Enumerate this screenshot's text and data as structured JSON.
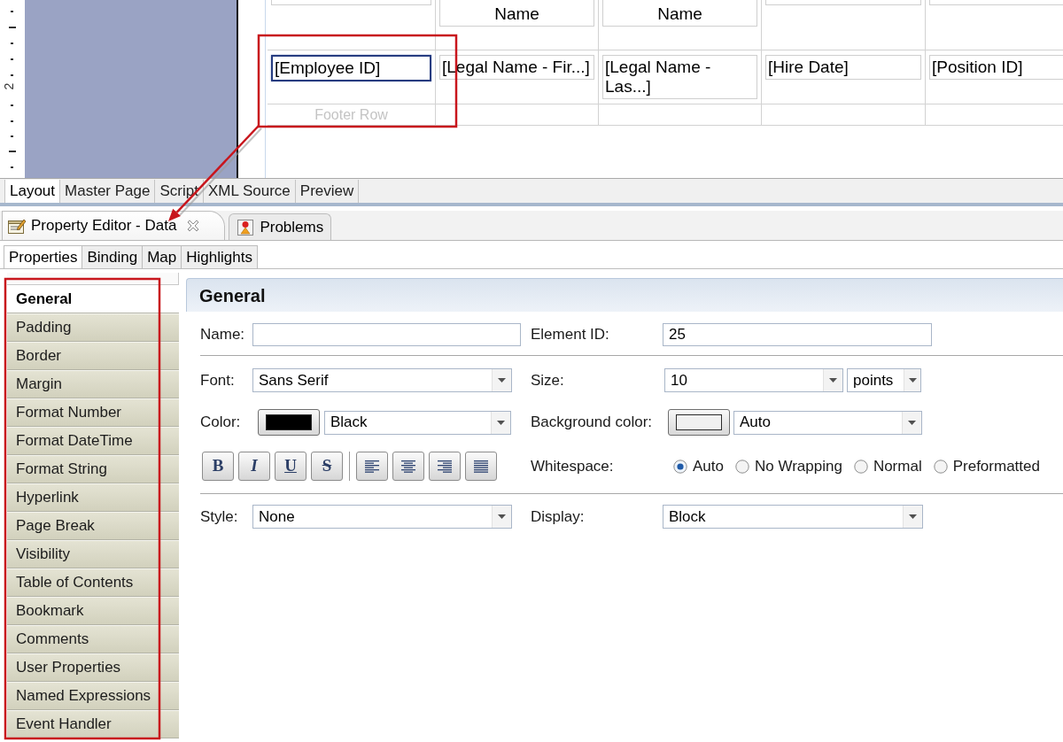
{
  "ruler": {
    "label": "2"
  },
  "report_table": {
    "columns": [
      {
        "detail": "[Employee ID]",
        "selected": true,
        "footer": "Footer Row"
      },
      {
        "header": "Name",
        "detail": "[Legal Name - Fir...]",
        "selected": false
      },
      {
        "header": "Name",
        "detail": "[Legal Name - Las...]",
        "selected": false
      },
      {
        "detail": "[Hire Date]",
        "selected": false
      },
      {
        "detail": "[Position ID]",
        "selected": false
      }
    ]
  },
  "editor_tabs": [
    {
      "label": "Layout",
      "selected": true
    },
    {
      "label": "Master Page",
      "selected": false
    },
    {
      "label": "Script",
      "selected": false
    },
    {
      "label": "XML Source",
      "selected": false
    },
    {
      "label": "Preview",
      "selected": false
    }
  ],
  "view_tabs": [
    {
      "kind": "property_editor",
      "label": "Property Editor - Data",
      "selected": true
    },
    {
      "kind": "problems",
      "label": "Problems",
      "selected": false
    }
  ],
  "property_tabs": [
    {
      "label": "Properties",
      "selected": true
    },
    {
      "label": "Binding",
      "selected": false
    },
    {
      "label": "Map",
      "selected": false
    },
    {
      "label": "Highlights",
      "selected": false
    }
  ],
  "categories": [
    {
      "label": "General",
      "selected": true
    },
    {
      "label": "Padding",
      "selected": false
    },
    {
      "label": "Border",
      "selected": false
    },
    {
      "label": "Margin",
      "selected": false
    },
    {
      "label": "Format Number",
      "selected": false
    },
    {
      "label": "Format DateTime",
      "selected": false
    },
    {
      "label": "Format String",
      "selected": false
    },
    {
      "label": "Hyperlink",
      "selected": false
    },
    {
      "label": "Page Break",
      "selected": false
    },
    {
      "label": "Visibility",
      "selected": false
    },
    {
      "label": "Table of Contents",
      "selected": false
    },
    {
      "label": "Bookmark",
      "selected": false
    },
    {
      "label": "Comments",
      "selected": false
    },
    {
      "label": "User Properties",
      "selected": false
    },
    {
      "label": "Named Expressions",
      "selected": false
    },
    {
      "label": "Event Handler",
      "selected": false
    }
  ],
  "section": {
    "title": "General",
    "name_field": {
      "label": "Name:"
    },
    "element_id": {
      "label": "Element ID:",
      "value": "25"
    },
    "font": {
      "label": "Font:",
      "value": "Sans Serif"
    },
    "size": {
      "label": "Size:",
      "value": "10",
      "unit": "points"
    },
    "color": {
      "label": "Color:",
      "value": "Black"
    },
    "background_color": {
      "label": "Background color:",
      "value": "Auto"
    },
    "text_style_buttons": [
      {
        "kind": "bold",
        "label": "B"
      },
      {
        "kind": "italic",
        "label": "I"
      },
      {
        "kind": "underline",
        "label": "U"
      },
      {
        "kind": "strikethrough",
        "label": "S"
      }
    ],
    "align_buttons": [
      {
        "kind": "left"
      },
      {
        "kind": "center"
      },
      {
        "kind": "right"
      },
      {
        "kind": "justify"
      }
    ],
    "whitespace": {
      "label": "Whitespace:",
      "options": [
        {
          "label": "Auto",
          "selected": true
        },
        {
          "label": "No Wrapping",
          "selected": false
        },
        {
          "label": "Normal",
          "selected": false
        },
        {
          "label": "Preformatted",
          "selected": false
        }
      ]
    },
    "style": {
      "label": "Style:",
      "value": "None"
    },
    "display": {
      "label": "Display:",
      "value": "Block"
    }
  }
}
